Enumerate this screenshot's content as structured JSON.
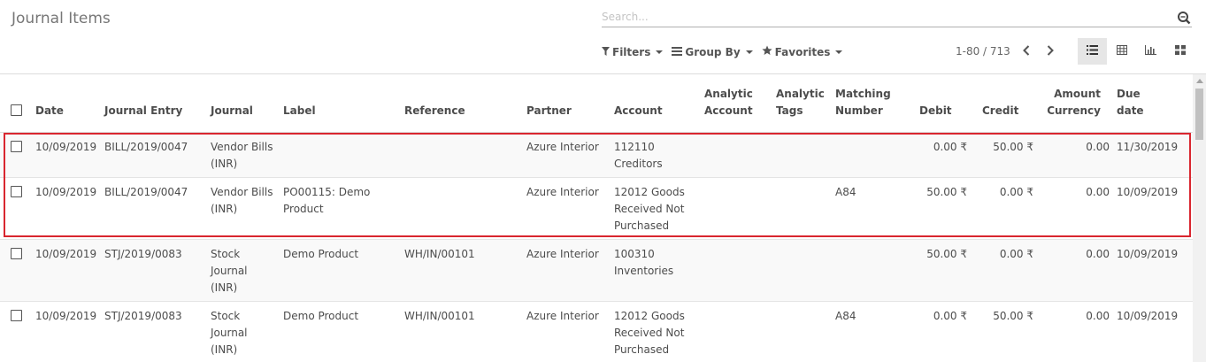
{
  "page": {
    "title": "Journal Items"
  },
  "search": {
    "placeholder": "Search..."
  },
  "toolbar": {
    "filters": "Filters",
    "group_by": "Group By",
    "favorites": "Favorites"
  },
  "pager": {
    "text": "1-80 / 713"
  },
  "views": [
    "list-view-icon",
    "pivot-view-icon",
    "graph-view-icon",
    "kanban-view-icon"
  ],
  "columns": {
    "date": "Date",
    "journal_entry": "Journal Entry",
    "journal": "Journal",
    "label": "Label",
    "reference": "Reference",
    "partner": "Partner",
    "account": "Account",
    "analytic_account_1": "Analytic",
    "analytic_account_2": "Account",
    "analytic_tags_1": "Analytic",
    "analytic_tags_2": "Tags",
    "matching_1": "Matching",
    "matching_2": "Number",
    "debit": "Debit",
    "credit": "Credit",
    "amount_currency_1": "Amount",
    "amount_currency_2": "Currency",
    "due_date_1": "Due",
    "due_date_2": "date"
  },
  "rows": [
    {
      "date": "10/09/2019",
      "entry": "BILL/2019/0047",
      "journal": [
        "Vendor Bills",
        "(INR)"
      ],
      "label": [],
      "reference": "",
      "partner": "Azure Interior",
      "account": [
        "112110",
        "Creditors"
      ],
      "matching": "",
      "debit": "0.00 ₹",
      "credit": "50.00 ₹",
      "amount_currency": "0.00",
      "due": "11/30/2019"
    },
    {
      "date": "10/09/2019",
      "entry": "BILL/2019/0047",
      "journal": [
        "Vendor Bills",
        "(INR)"
      ],
      "label": [
        "PO00115: Demo",
        "Product"
      ],
      "reference": "",
      "partner": "Azure Interior",
      "account": [
        "12012 Goods",
        "Received Not",
        "Purchased"
      ],
      "matching": "A84",
      "debit": "50.00 ₹",
      "credit": "0.00 ₹",
      "amount_currency": "0.00",
      "due": "10/09/2019"
    },
    {
      "date": "10/09/2019",
      "entry": "STJ/2019/0083",
      "journal": [
        "Stock",
        "Journal",
        "(INR)"
      ],
      "label": [
        "Demo Product"
      ],
      "reference": "WH/IN/00101",
      "partner": "Azure Interior",
      "account": [
        "100310",
        "Inventories"
      ],
      "matching": "",
      "debit": "50.00 ₹",
      "credit": "0.00 ₹",
      "amount_currency": "0.00",
      "due": "10/09/2019"
    },
    {
      "date": "10/09/2019",
      "entry": "STJ/2019/0083",
      "journal": [
        "Stock",
        "Journal",
        "(INR)"
      ],
      "label": [
        "Demo Product"
      ],
      "reference": "WH/IN/00101",
      "partner": "Azure Interior",
      "account": [
        "12012 Goods",
        "Received Not",
        "Purchased"
      ],
      "matching": "A84",
      "debit": "0.00 ₹",
      "credit": "50.00 ₹",
      "amount_currency": "0.00",
      "due": "10/09/2019"
    }
  ]
}
